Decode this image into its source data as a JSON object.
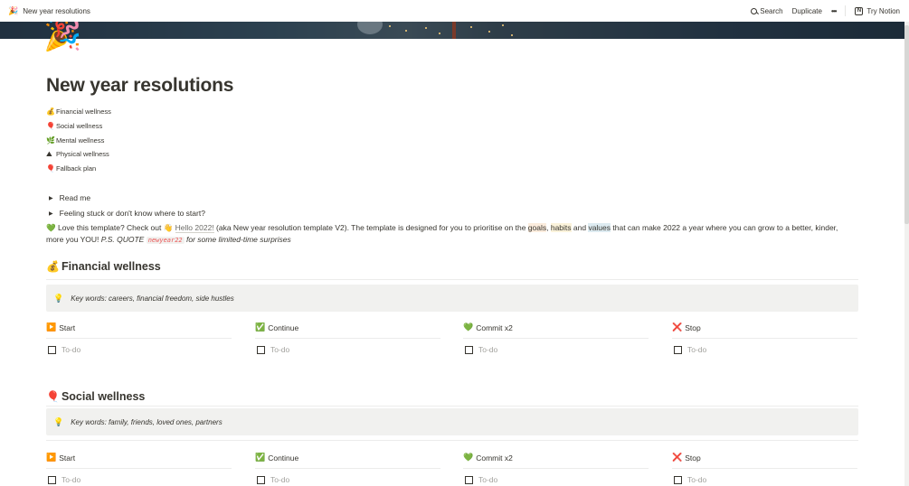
{
  "topbar": {
    "page_icon": "🎉",
    "page_title": "New year resolutions",
    "search_label": "Search",
    "duplicate_label": "Duplicate",
    "more_label": "•••",
    "try_notion_label": "Try Notion",
    "notion_logo": "N"
  },
  "page": {
    "icon": "🎉",
    "title": "New year resolutions"
  },
  "toc": [
    {
      "emoji": "💰",
      "label": "Financial wellness"
    },
    {
      "emoji": "🎈",
      "label": "Social wellness"
    },
    {
      "emoji": "🌿",
      "label": "Mental wellness"
    },
    {
      "emoji": "⛰",
      "label": "Physical wellness"
    },
    {
      "emoji": "🎈",
      "label": "Fallback plan"
    }
  ],
  "toggles": [
    {
      "label": "Read me"
    },
    {
      "label": "Feeling stuck or don't know where to start?"
    }
  ],
  "intro": {
    "heart": "💚",
    "text1": "Love this template? Check out ",
    "mention_emoji": "👋",
    "mention": "Hello 2022!",
    "text2": " (aka New year resolution template V2). The template is designed for you to prioritise on the ",
    "goals": "goals",
    "comma": ", ",
    "habits": "habits",
    "and": " and ",
    "values": "values",
    "text3": " that can make 2022 a year where you can grow to a better, kinder, more you YOU! ",
    "ps": "P.S. QUOTE ",
    "code": "newyear22",
    "ps2": " for some limited-time surprises"
  },
  "sections": [
    {
      "emoji": "💰",
      "heading": "Financial wellness",
      "callout_emoji": "💡",
      "callout": "Key words: careers, financial freedom, side hustles",
      "columns": [
        {
          "emoji": "▶️",
          "label": "Start",
          "todo": "To-do"
        },
        {
          "emoji": "✅",
          "label": "Continue",
          "todo": "To-do"
        },
        {
          "emoji": "💚",
          "label": "Commit x2",
          "todo": "To-do"
        },
        {
          "emoji": "❌",
          "label": "Stop",
          "todo": "To-do"
        }
      ]
    },
    {
      "emoji": "🎈",
      "heading": "Social wellness",
      "callout_emoji": "💡",
      "callout": "Key words: family, friends, loved ones, partners",
      "columns": [
        {
          "emoji": "▶️",
          "label": "Start",
          "todo": "To-do"
        },
        {
          "emoji": "✅",
          "label": "Continue",
          "todo": "To-do"
        },
        {
          "emoji": "💚",
          "label": "Commit x2",
          "todo": "To-do"
        },
        {
          "emoji": "❌",
          "label": "Stop",
          "todo": "To-do"
        }
      ]
    }
  ]
}
